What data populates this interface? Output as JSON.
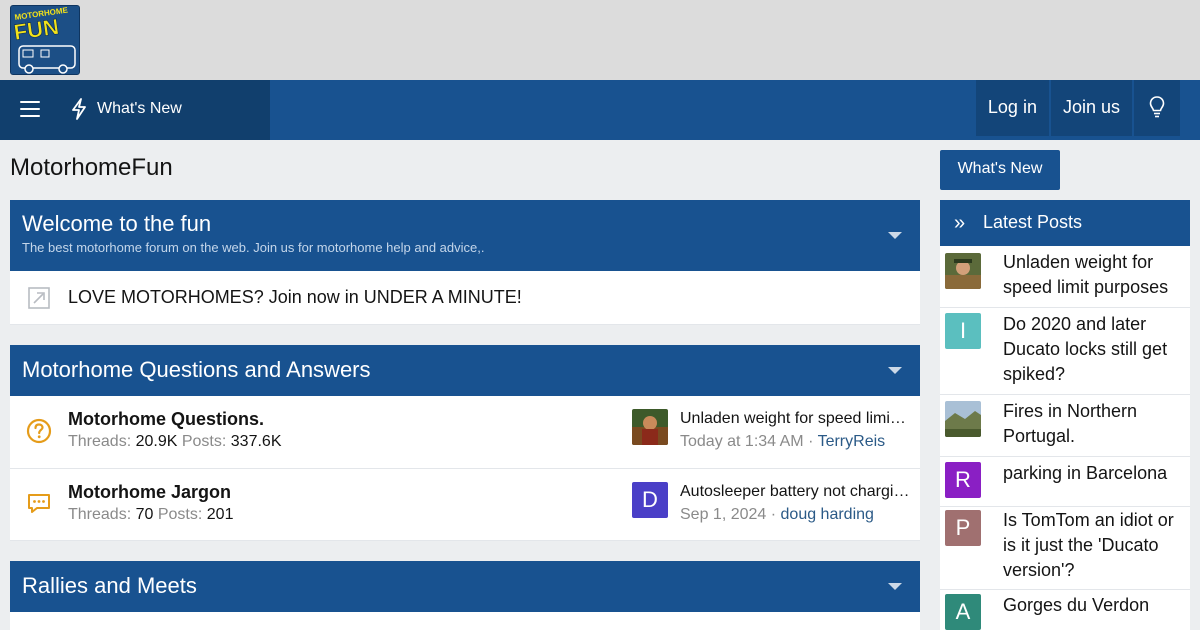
{
  "logo": {
    "icon": "motorhome-fun-logo",
    "text": "MOTORHOME FUN"
  },
  "nav": {
    "whats_new": "What's New",
    "login": "Log in",
    "join": "Join us"
  },
  "page": {
    "title": "MotorhomeFun"
  },
  "blocks": [
    {
      "title": "Welcome to the fun",
      "description": "The best motorhome forum on the web. Join us for motorhome help and advice,.",
      "link": "LOVE MOTORHOMES? Join now in UNDER A MINUTE!"
    },
    {
      "title": "Motorhome Questions and Answers",
      "forums": [
        {
          "title": "Motorhome Questions.",
          "threads_label": "Threads:",
          "threads": "20.9K",
          "posts_label": "Posts:",
          "posts": "337.6K",
          "icon": "question-icon",
          "last_title": "Unladen weight for speed limit purposes",
          "last_time": "Today at 1:34 AM",
          "last_sep": " · ",
          "last_user": "TerryReis"
        },
        {
          "title": "Motorhome Jargon",
          "threads_label": "Threads:",
          "threads": "70",
          "posts_label": "Posts:",
          "posts": "201",
          "icon": "chat-bubble-icon",
          "last_title": "Autosleeper battery not charging",
          "last_time": "Sep 1, 2024",
          "last_sep": " · ",
          "last_user": "doug harding",
          "avatar_letter": "D"
        }
      ]
    },
    {
      "title": "Rallies and Meets"
    }
  ],
  "sidebar": {
    "whats_new_button": "What's New",
    "latest_title": "Latest Posts",
    "latest_icon": "»",
    "items": [
      {
        "title": "Unladen weight for speed limit purposes",
        "avatar": "photo"
      },
      {
        "title": "Do 2020 and later Ducato locks still get spiked?",
        "letter": "I",
        "color": "#5bbfbf"
      },
      {
        "title": "Fires in Northern Portugal.",
        "avatar": "photo"
      },
      {
        "title": "parking in Barcelona",
        "letter": "R",
        "color": "#8a1fc4"
      },
      {
        "title": "Is TomTom an idiot or is it just the 'Ducato version'?",
        "letter": "P",
        "color": "#a07070"
      },
      {
        "title": "Gorges du Verdon",
        "letter": "A",
        "color": "#2f8a7a"
      }
    ]
  },
  "colors": {
    "nav": "#185290",
    "nav_dark": "#113f6d",
    "accent_orange": "#e59c1a"
  }
}
